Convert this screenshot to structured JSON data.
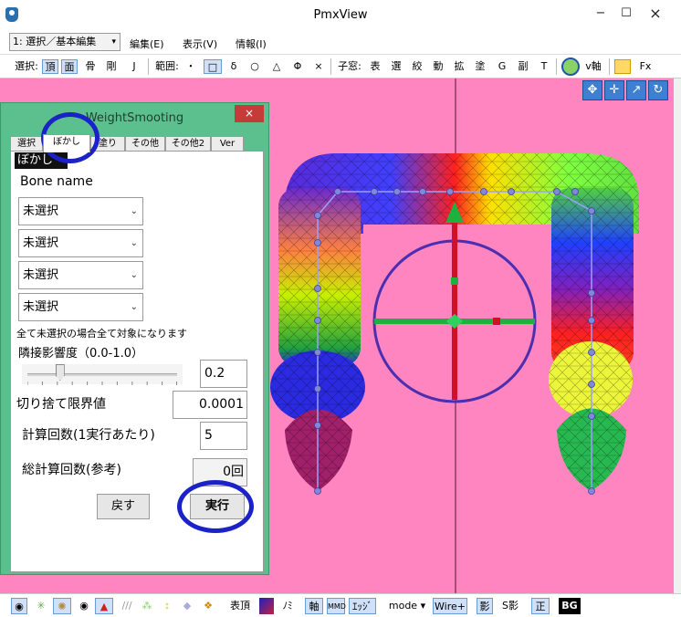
{
  "window": {
    "title": "PmxView",
    "min": "−",
    "max": "☐",
    "close": "×"
  },
  "menubar": {
    "mode_select": "1: 選択／基本編集",
    "items": [
      "編集(E)",
      "表示(V)",
      "情報(I)"
    ]
  },
  "toolbar": {
    "select_label": "選択:",
    "select_items": [
      "頂",
      "面",
      "骨",
      "剛",
      "J"
    ],
    "range_label": "範囲:",
    "range_items": [
      "・",
      "□",
      "δ",
      "○",
      "△",
      "Φ",
      "×"
    ],
    "subwin_label": "子窓:",
    "subwin_items": [
      "表",
      "選",
      "絞",
      "動",
      "拡",
      "塗",
      "G",
      "副",
      "T"
    ],
    "v_axis": "v軸",
    "fx": "Fx"
  },
  "dialog": {
    "title": "WeightSmooting",
    "close": "×",
    "tabs": [
      "選択",
      "ぼかし",
      "塗り",
      "その他",
      "その他2",
      "Ver"
    ],
    "active_tab": 1,
    "section_label": "ぼかし",
    "bone_name_label": "Bone name",
    "bone_selects": [
      "未選択",
      "未選択",
      "未選択",
      "未選択"
    ],
    "note": "全て未選択の場合全て対象になります",
    "adjacent_label": "隣接影響度（0.0-1.0）",
    "slider_value": 0.2,
    "adjacent_value": "0.2",
    "cutoff_label": "切り捨て限界値",
    "cutoff_value": "0.0001",
    "iterations_label": "計算回数(1実行あたり)",
    "iterations_value": "5",
    "total_label": "総計算回数(参考)",
    "total_value": "0回",
    "return_button": "戻す",
    "run_button": "実行"
  },
  "statusbar": {
    "vertex_label": "表頂",
    "no_label": "ﾉﾐ",
    "axis": "軸",
    "mmd": "MMD",
    "edge": "ｴｯｼﾞ",
    "mode": "mode",
    "wire": "Wire+",
    "shadow": "影",
    "s_shadow": "S影",
    "positive": "正",
    "bg": "BG"
  },
  "colors": {
    "viewport_bg": "#ff85c0",
    "dialog_bg": "#5cbf8e",
    "annotation": "#1a22c8"
  }
}
